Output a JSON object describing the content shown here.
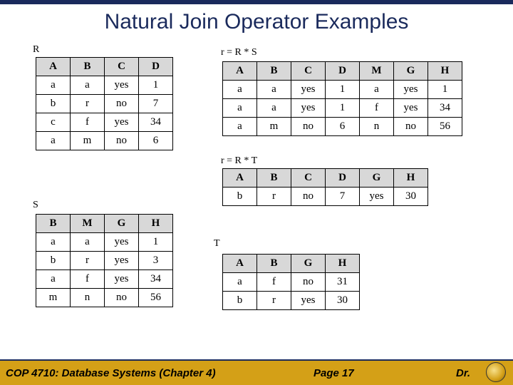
{
  "title": "Natural Join Operator Examples",
  "labels": {
    "R": "R",
    "S": "S",
    "T": "T",
    "RS": "r = R * S",
    "RT": "r = R * T"
  },
  "R": {
    "headers": [
      "A",
      "B",
      "C",
      "D"
    ],
    "rows": [
      [
        "a",
        "a",
        "yes",
        "1"
      ],
      [
        "b",
        "r",
        "no",
        "7"
      ],
      [
        "c",
        "f",
        "yes",
        "34"
      ],
      [
        "a",
        "m",
        "no",
        "6"
      ]
    ]
  },
  "S": {
    "headers": [
      "B",
      "M",
      "G",
      "H"
    ],
    "rows": [
      [
        "a",
        "a",
        "yes",
        "1"
      ],
      [
        "b",
        "r",
        "yes",
        "3"
      ],
      [
        "a",
        "f",
        "yes",
        "34"
      ],
      [
        "m",
        "n",
        "no",
        "56"
      ]
    ]
  },
  "RS": {
    "headers": [
      "A",
      "B",
      "C",
      "D",
      "M",
      "G",
      "H"
    ],
    "rows": [
      [
        "a",
        "a",
        "yes",
        "1",
        "a",
        "yes",
        "1"
      ],
      [
        "a",
        "a",
        "yes",
        "1",
        "f",
        "yes",
        "34"
      ],
      [
        "a",
        "m",
        "no",
        "6",
        "n",
        "no",
        "56"
      ]
    ]
  },
  "RT": {
    "headers": [
      "A",
      "B",
      "C",
      "D",
      "G",
      "H"
    ],
    "rows": [
      [
        "b",
        "r",
        "no",
        "7",
        "yes",
        "30"
      ]
    ]
  },
  "T": {
    "headers": [
      "A",
      "B",
      "G",
      "H"
    ],
    "rows": [
      [
        "a",
        "f",
        "no",
        "31"
      ],
      [
        "b",
        "r",
        "yes",
        "30"
      ]
    ]
  },
  "footer": {
    "course": "COP 4710: Database Systems  (Chapter 4)",
    "page": "Page 17",
    "author": "Dr."
  }
}
